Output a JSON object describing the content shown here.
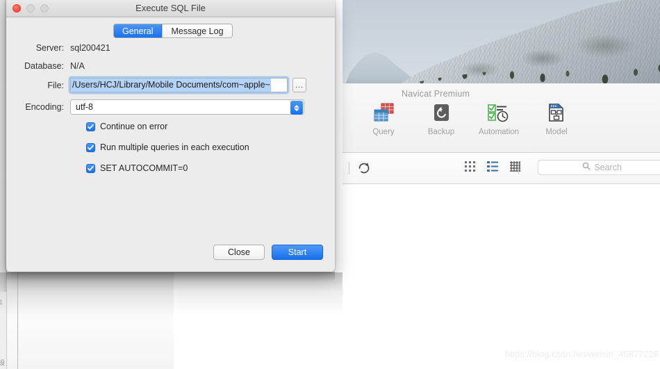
{
  "dialog": {
    "title": "Execute SQL File",
    "traffic_lights": [
      "close-red",
      "minimize-gray",
      "maximize-gray"
    ],
    "tabs": [
      {
        "label": "General",
        "active": true
      },
      {
        "label": "Message Log",
        "active": false
      }
    ],
    "fields": {
      "server_label": "Server:",
      "server_value": "sql200421",
      "database_label": "Database:",
      "database_value": "N/A",
      "file_label": "File:",
      "file_value": "/Users/HCJ/Library/Mobile Documents/com~apple~",
      "browse_button": "...",
      "encoding_label": "Encoding:",
      "encoding_value": "utf-8"
    },
    "checkboxes": [
      {
        "label": "Continue on error",
        "checked": true
      },
      {
        "label": "Run multiple queries in each execution",
        "checked": true
      },
      {
        "label": "SET AUTOCOMMIT=0",
        "checked": true
      }
    ],
    "buttons": {
      "close": "Close",
      "start": "Start"
    },
    "colors": {
      "accent_blue": "#1d72ec",
      "selection_blue": "#b5d3f7",
      "focus_ring": "#7eade5",
      "window_bg": "#ececec"
    }
  },
  "background": {
    "app_title": "Navicat Premium",
    "toolbar_items": [
      {
        "label": "Query",
        "icon": "query-table-icon"
      },
      {
        "label": "Backup",
        "icon": "backup-restore-icon"
      },
      {
        "label": "Automation",
        "icon": "automation-clock-icon"
      },
      {
        "label": "Model",
        "icon": "model-diagram-icon"
      }
    ],
    "refresh_icon": "refresh-icon",
    "view_toggles": [
      {
        "icon": "grid-view-icon",
        "active": false
      },
      {
        "icon": "list-view-icon",
        "active": true
      },
      {
        "icon": "detail-grid-icon",
        "active": false
      }
    ],
    "search": {
      "placeholder": "Search",
      "icon": "search-icon"
    },
    "edge_fragments": [
      "1",
      "设"
    ],
    "watermark": "https://blog.csdn.net/weixin_45877226"
  }
}
